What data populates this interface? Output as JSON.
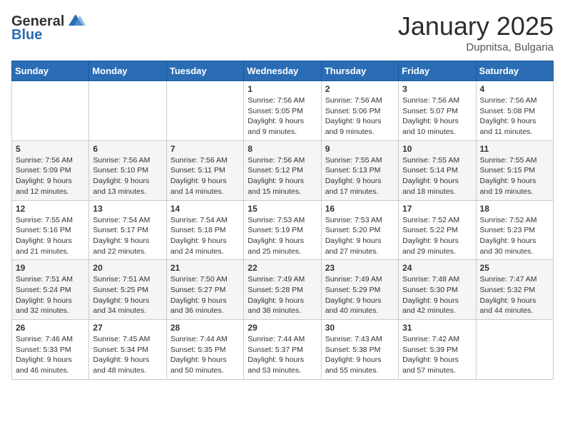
{
  "logo": {
    "general": "General",
    "blue": "Blue"
  },
  "title": "January 2025",
  "location": "Dupnitsa, Bulgaria",
  "days_header": [
    "Sunday",
    "Monday",
    "Tuesday",
    "Wednesday",
    "Thursday",
    "Friday",
    "Saturday"
  ],
  "weeks": [
    [
      {
        "day": "",
        "info": ""
      },
      {
        "day": "",
        "info": ""
      },
      {
        "day": "",
        "info": ""
      },
      {
        "day": "1",
        "info": "Sunrise: 7:56 AM\nSunset: 5:05 PM\nDaylight: 9 hours\nand 9 minutes."
      },
      {
        "day": "2",
        "info": "Sunrise: 7:56 AM\nSunset: 5:06 PM\nDaylight: 9 hours\nand 9 minutes."
      },
      {
        "day": "3",
        "info": "Sunrise: 7:56 AM\nSunset: 5:07 PM\nDaylight: 9 hours\nand 10 minutes."
      },
      {
        "day": "4",
        "info": "Sunrise: 7:56 AM\nSunset: 5:08 PM\nDaylight: 9 hours\nand 11 minutes."
      }
    ],
    [
      {
        "day": "5",
        "info": "Sunrise: 7:56 AM\nSunset: 5:09 PM\nDaylight: 9 hours\nand 12 minutes."
      },
      {
        "day": "6",
        "info": "Sunrise: 7:56 AM\nSunset: 5:10 PM\nDaylight: 9 hours\nand 13 minutes."
      },
      {
        "day": "7",
        "info": "Sunrise: 7:56 AM\nSunset: 5:11 PM\nDaylight: 9 hours\nand 14 minutes."
      },
      {
        "day": "8",
        "info": "Sunrise: 7:56 AM\nSunset: 5:12 PM\nDaylight: 9 hours\nand 15 minutes."
      },
      {
        "day": "9",
        "info": "Sunrise: 7:55 AM\nSunset: 5:13 PM\nDaylight: 9 hours\nand 17 minutes."
      },
      {
        "day": "10",
        "info": "Sunrise: 7:55 AM\nSunset: 5:14 PM\nDaylight: 9 hours\nand 18 minutes."
      },
      {
        "day": "11",
        "info": "Sunrise: 7:55 AM\nSunset: 5:15 PM\nDaylight: 9 hours\nand 19 minutes."
      }
    ],
    [
      {
        "day": "12",
        "info": "Sunrise: 7:55 AM\nSunset: 5:16 PM\nDaylight: 9 hours\nand 21 minutes."
      },
      {
        "day": "13",
        "info": "Sunrise: 7:54 AM\nSunset: 5:17 PM\nDaylight: 9 hours\nand 22 minutes."
      },
      {
        "day": "14",
        "info": "Sunrise: 7:54 AM\nSunset: 5:18 PM\nDaylight: 9 hours\nand 24 minutes."
      },
      {
        "day": "15",
        "info": "Sunrise: 7:53 AM\nSunset: 5:19 PM\nDaylight: 9 hours\nand 25 minutes."
      },
      {
        "day": "16",
        "info": "Sunrise: 7:53 AM\nSunset: 5:20 PM\nDaylight: 9 hours\nand 27 minutes."
      },
      {
        "day": "17",
        "info": "Sunrise: 7:52 AM\nSunset: 5:22 PM\nDaylight: 9 hours\nand 29 minutes."
      },
      {
        "day": "18",
        "info": "Sunrise: 7:52 AM\nSunset: 5:23 PM\nDaylight: 9 hours\nand 30 minutes."
      }
    ],
    [
      {
        "day": "19",
        "info": "Sunrise: 7:51 AM\nSunset: 5:24 PM\nDaylight: 9 hours\nand 32 minutes."
      },
      {
        "day": "20",
        "info": "Sunrise: 7:51 AM\nSunset: 5:25 PM\nDaylight: 9 hours\nand 34 minutes."
      },
      {
        "day": "21",
        "info": "Sunrise: 7:50 AM\nSunset: 5:27 PM\nDaylight: 9 hours\nand 36 minutes."
      },
      {
        "day": "22",
        "info": "Sunrise: 7:49 AM\nSunset: 5:28 PM\nDaylight: 9 hours\nand 38 minutes."
      },
      {
        "day": "23",
        "info": "Sunrise: 7:49 AM\nSunset: 5:29 PM\nDaylight: 9 hours\nand 40 minutes."
      },
      {
        "day": "24",
        "info": "Sunrise: 7:48 AM\nSunset: 5:30 PM\nDaylight: 9 hours\nand 42 minutes."
      },
      {
        "day": "25",
        "info": "Sunrise: 7:47 AM\nSunset: 5:32 PM\nDaylight: 9 hours\nand 44 minutes."
      }
    ],
    [
      {
        "day": "26",
        "info": "Sunrise: 7:46 AM\nSunset: 5:33 PM\nDaylight: 9 hours\nand 46 minutes."
      },
      {
        "day": "27",
        "info": "Sunrise: 7:45 AM\nSunset: 5:34 PM\nDaylight: 9 hours\nand 48 minutes."
      },
      {
        "day": "28",
        "info": "Sunrise: 7:44 AM\nSunset: 5:35 PM\nDaylight: 9 hours\nand 50 minutes."
      },
      {
        "day": "29",
        "info": "Sunrise: 7:44 AM\nSunset: 5:37 PM\nDaylight: 9 hours\nand 53 minutes."
      },
      {
        "day": "30",
        "info": "Sunrise: 7:43 AM\nSunset: 5:38 PM\nDaylight: 9 hours\nand 55 minutes."
      },
      {
        "day": "31",
        "info": "Sunrise: 7:42 AM\nSunset: 5:39 PM\nDaylight: 9 hours\nand 57 minutes."
      },
      {
        "day": "",
        "info": ""
      }
    ]
  ]
}
